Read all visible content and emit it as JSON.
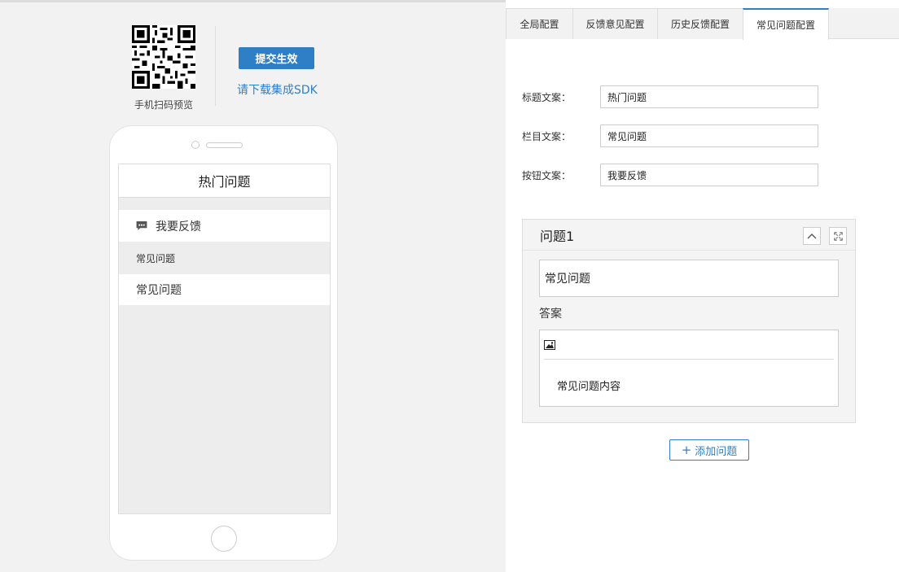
{
  "qr": {
    "caption": "手机扫码预览"
  },
  "actions": {
    "submit_label": "提交生效",
    "sdk_link": "请下载集成SDK"
  },
  "preview": {
    "header_title": "热门问题",
    "feedback_label": "我要反馈",
    "section_title": "常见问题",
    "items": [
      "常见问题"
    ]
  },
  "tabs": [
    {
      "label": "全局配置",
      "active": false
    },
    {
      "label": "反馈意见配置",
      "active": false
    },
    {
      "label": "历史反馈配置",
      "active": false
    },
    {
      "label": "常见问题配置",
      "active": true
    }
  ],
  "form": {
    "title_label": "标题文案：",
    "title_value": "热门问题",
    "column_label": "栏目文案：",
    "column_value": "常见问题",
    "button_label": "按钮文案：",
    "button_value": "我要反馈"
  },
  "question": {
    "heading": "问题1",
    "title_value": "常见问题",
    "answer_label": "答案",
    "answer_content": "常见问题内容"
  },
  "add_button": {
    "plus": "+",
    "label": "添加问题"
  },
  "colors": {
    "accent": "#2f7fc6",
    "background": "#f2f2f2"
  },
  "icons": [
    "qr-code-icon",
    "chat-icon",
    "chevron-up-icon",
    "expand-icon",
    "image-icon",
    "plus-icon"
  ]
}
